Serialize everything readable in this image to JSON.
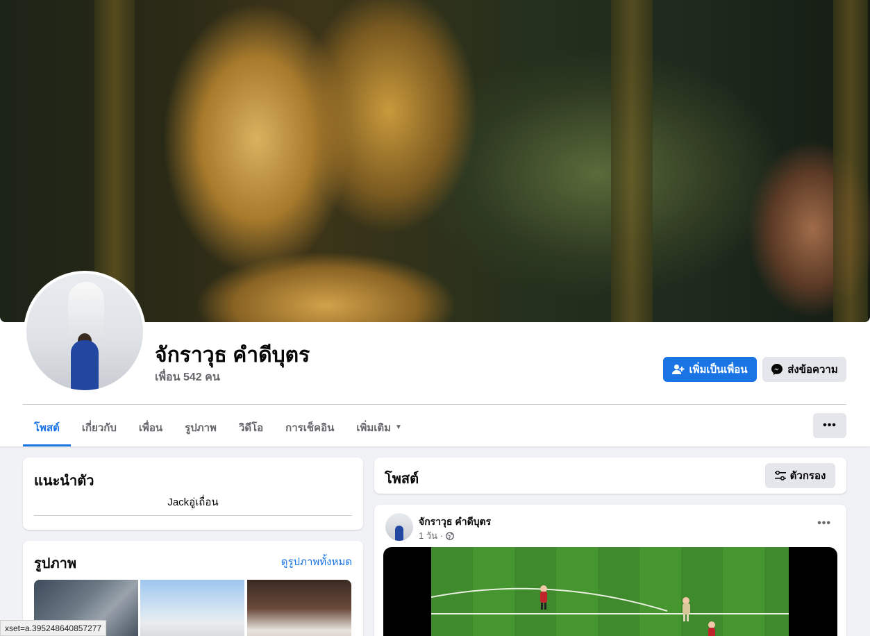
{
  "profile": {
    "name": "จักราวุธ คำดีบุตร",
    "friends_text": "เพื่อน 542 คน"
  },
  "actions": {
    "add_friend": "เพิ่มเป็นเพื่อน",
    "message": "ส่งข้อความ",
    "more": "•••"
  },
  "tabs": [
    {
      "label": "โพสต์",
      "active": true
    },
    {
      "label": "เกี่ยวกับ"
    },
    {
      "label": "เพื่อน"
    },
    {
      "label": "รูปภาพ"
    },
    {
      "label": "วิดีโอ"
    },
    {
      "label": "การเช็คอิน"
    },
    {
      "label": "เพิ่มเติม"
    }
  ],
  "intro": {
    "title": "แนะนำตัว",
    "bio": "Jackอู่เถื่อน"
  },
  "photos": {
    "title": "รูปภาพ",
    "see_all": "ดูรูปภาพทั้งหมด"
  },
  "posts": {
    "title": "โพสต์",
    "filter_label": "ตัวกรอง"
  },
  "post": {
    "author": "จักราวุธ คำดีบุตร",
    "time": "1 วัน ·",
    "more": "•••"
  },
  "status_bar": {
    "url": "xset=a.395248640857277"
  },
  "colors": {
    "primary": "#1b74e4",
    "secondary_button": "#e4e6eb",
    "page_background": "#f0f2f5",
    "muted_text": "#65676b"
  },
  "icons": [
    "add-friend-icon",
    "messenger-icon",
    "caret-down-icon",
    "filter-icon",
    "globe-icon"
  ]
}
